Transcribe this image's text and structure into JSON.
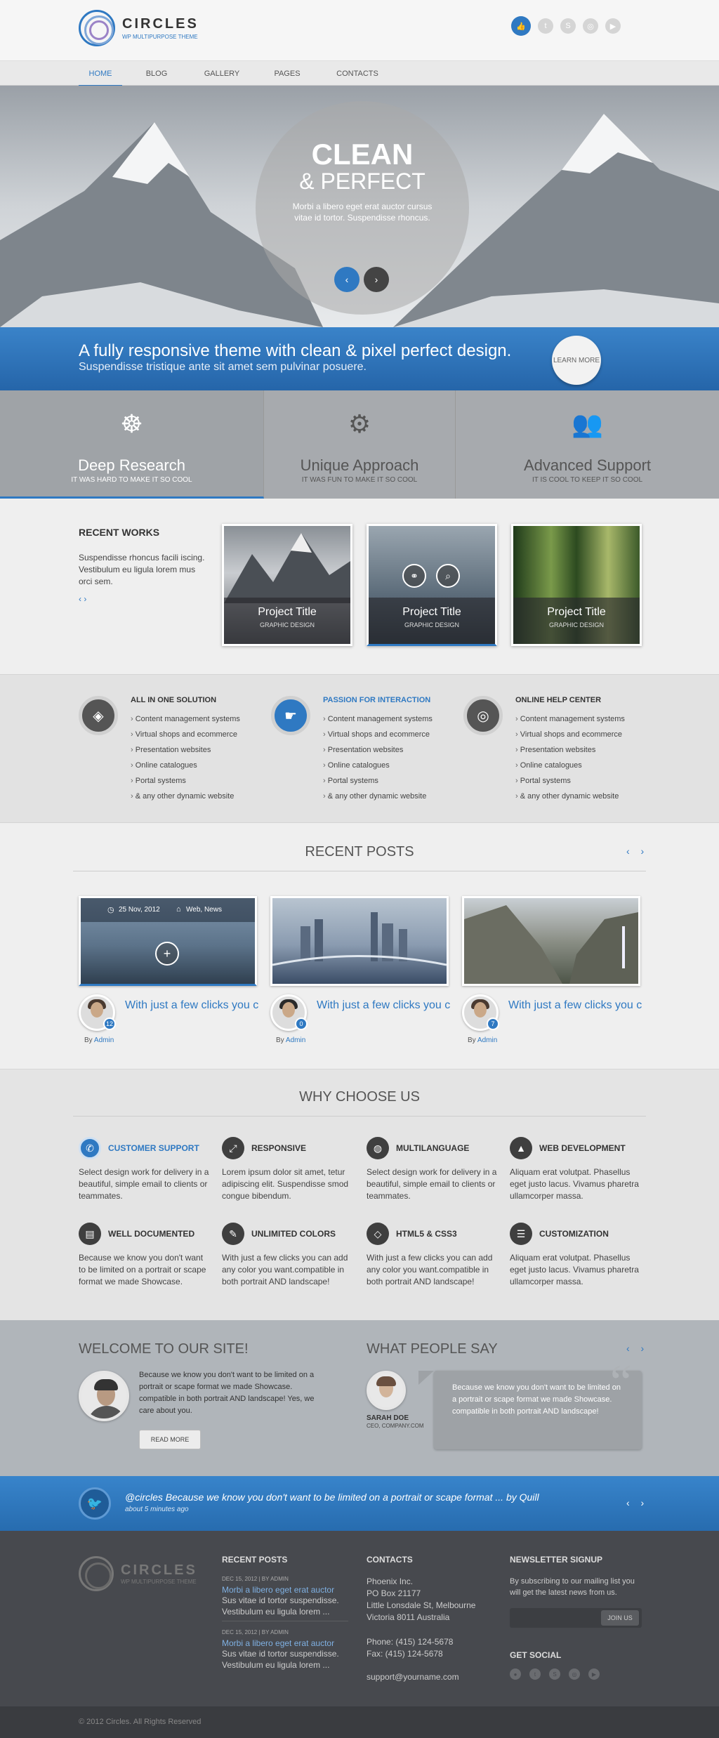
{
  "header": {
    "logo_name": "CIRCLES",
    "logo_sub": "WP MULTIPURPOSE THEME",
    "social": [
      "like-icon",
      "twitter-icon",
      "skype-icon",
      "dribbble-icon",
      "youtube-icon"
    ]
  },
  "nav": [
    "HOME",
    "BLOG",
    "GALLERY",
    "PAGES",
    "CONTACTS"
  ],
  "hero": {
    "title1": "CLEAN",
    "title2": "& PERFECT",
    "text": "Morbi a libero eget erat auctor cursus vitae id tortor. Suspendisse rhoncus.",
    "prev": "‹",
    "next": "›"
  },
  "banner": {
    "line1": "A fully responsive theme with clean & pixel perfect design.",
    "line2": "Suspendisse tristique ante sit amet sem pulvinar posuere.",
    "button": "LEARN MORE"
  },
  "features": [
    {
      "title": "Deep Research",
      "sub": "IT WAS HARD TO MAKE IT SO COOL"
    },
    {
      "title": "Unique Approach",
      "sub": "IT WAS FUN TO MAKE IT SO COOL"
    },
    {
      "title": "Advanced Support",
      "sub": "IT IS COOL TO KEEP IT SO COOL"
    }
  ],
  "recent_works": {
    "title": "RECENT WORKS",
    "desc": "Suspendisse rhoncus facili iscing. Vestibulum eu ligula lorem mus orci sem.",
    "nav": "‹ ›",
    "items": [
      {
        "title": "Project Title",
        "sub": "GRAPHIC DESIGN"
      },
      {
        "title": "Project Title",
        "sub": "GRAPHIC DESIGN"
      },
      {
        "title": "Project Title",
        "sub": "GRAPHIC DESIGN"
      }
    ]
  },
  "solutions": [
    {
      "title": "ALL IN ONE SOLUTION",
      "items": [
        "Content management systems",
        "Virtual shops and ecommerce",
        "Presentation websites",
        "Online catalogues",
        "Portal systems",
        "& any other dynamic website"
      ]
    },
    {
      "title": "PASSION FOR INTERACTION",
      "items": [
        "Content management systems",
        "Virtual shops and ecommerce",
        "Presentation websites",
        "Online catalogues",
        "Portal systems",
        "& any other dynamic website"
      ]
    },
    {
      "title": "ONLINE HELP CENTER",
      "items": [
        "Content management systems",
        "Virtual shops and ecommerce",
        "Presentation websites",
        "Online catalogues",
        "Portal systems",
        "& any other dynamic website"
      ]
    }
  ],
  "recent_posts": {
    "title": "RECENT POSTS",
    "nav": "‹ ›",
    "meta_date": "25 Nov, 2012",
    "meta_tags": "Web, News",
    "items": [
      {
        "title": "With just a few clicks you can add in both portrait ...",
        "count": "12",
        "by": "By",
        "author": "Admin"
      },
      {
        "title": "With just a few clicks you can add in both portrait ...",
        "count": "0",
        "by": "By",
        "author": "Admin"
      },
      {
        "title": "With just a few clicks you can add in both portrait ...",
        "count": "7",
        "by": "By",
        "author": "Admin"
      }
    ]
  },
  "why": {
    "title": "WHY CHOOSE US",
    "items": [
      {
        "title": "CUSTOMER SUPPORT",
        "desc": "Select design work for delivery in a beautiful, simple email to clients or teammates."
      },
      {
        "title": "RESPONSIVE",
        "desc": "Lorem ipsum dolor sit amet, tetur adipiscing elit. Suspendisse smod congue bibendum."
      },
      {
        "title": "MULTILANGUAGE",
        "desc": "Select design work for delivery in a beautiful, simple email to clients or teammates."
      },
      {
        "title": "WEB DEVELOPMENT",
        "desc": "Aliquam erat volutpat. Phasellus eget justo lacus. Vivamus pharetra ullamcorper massa."
      },
      {
        "title": "WELL DOCUMENTED",
        "desc": "Because we know you don't want to be limited on a portrait or scape format we made Showcase."
      },
      {
        "title": "UNLIMITED COLORS",
        "desc": "With just a few clicks you can add any color you want.compatible in both portrait AND landscape!"
      },
      {
        "title": "HTML5 & CSS3",
        "desc": "With just a few clicks you can add any color you want.compatible in both portrait AND landscape!"
      },
      {
        "title": "CUSTOMIZATION",
        "desc": "Aliquam erat volutpat. Phasellus eget justo lacus. Vivamus pharetra ullamcorper massa."
      }
    ]
  },
  "welcome": {
    "title": "WELCOME TO OUR SITE!",
    "text": "Because we know you don't want to be limited on a portrait or scape format we made Showcase. compatible in both portrait AND landscape! Yes, we care about you.",
    "button": "READ MORE"
  },
  "testimonial": {
    "title": "WHAT PEOPLE SAY",
    "nav": "‹ ›",
    "name": "SARAH DOE",
    "role": "CEO, COMPANY.COM",
    "quote": "Because we know you don't want to be limited on a portrait or scape format we made Showcase. compatible in both portrait AND landscape!"
  },
  "tweet": {
    "handle": "@circles",
    "text": " Because we know you don't want to be limited on a portrait or scape format ... ",
    "by": "by Quill",
    "time": "about 5 minutes ago",
    "nav": "‹ ›"
  },
  "footer": {
    "logo_name": "CIRCLES",
    "logo_sub": "WP MULTIPURPOSE THEME",
    "posts_title": "RECENT POSTS",
    "posts": [
      {
        "meta": "DEC 15, 2012  |  BY ADMIN",
        "link": "Morbi a libero eget erat auctor",
        "desc": "Sus vitae id tortor suspendisse. Vestibulum eu ligula lorem ..."
      },
      {
        "meta": "DEC 15, 2012  |  BY ADMIN",
        "link": "Morbi a libero eget erat auctor",
        "desc": "Sus vitae id tortor suspendisse. Vestibulum eu ligula lorem ..."
      }
    ],
    "contacts_title": "CONTACTS",
    "contacts": [
      "Phoenix Inc.",
      "PO Box 21177",
      "Little Lonsdale St, Melbourne",
      "Victoria 8011 Australia"
    ],
    "phone": "Phone: (415) 124-5678",
    "fax": "Fax: (415) 124-5678",
    "email": "support@yourname.com",
    "newsletter_title": "NEWSLETTER SIGNUP",
    "newsletter_text": "By subscribing to our mailing list you will get the latest news from us.",
    "join": "JOIN US",
    "social_title": "GET SOCIAL",
    "copyright": "© 2012 Circles. All Rights Reserved"
  }
}
